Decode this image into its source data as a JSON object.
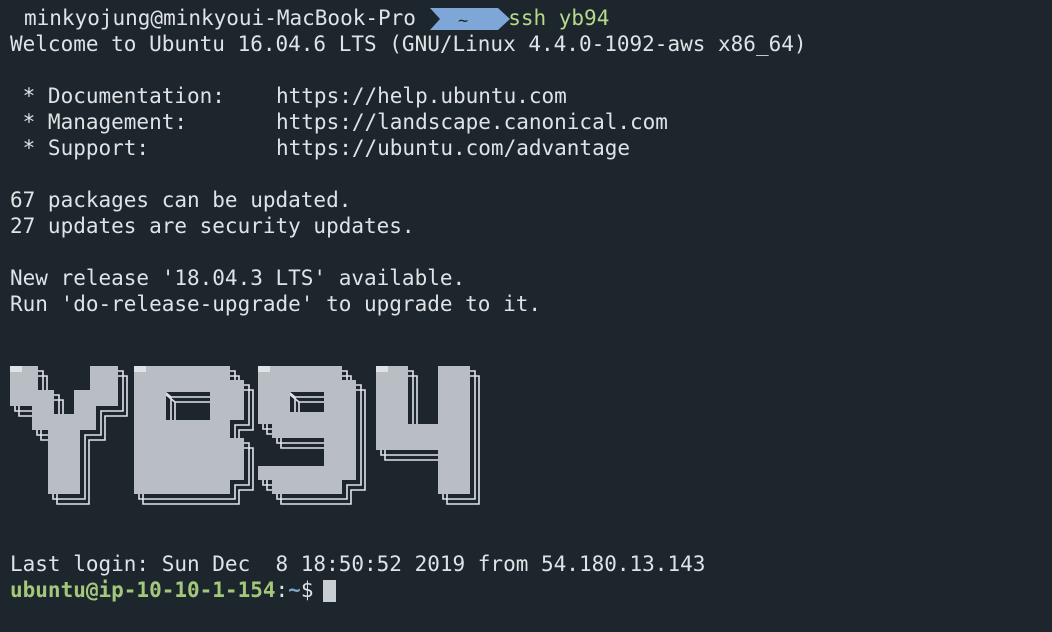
{
  "prompt": {
    "user_host": "minkyojung@minkyoui-MacBook-Pro",
    "dir": "~",
    "command": "ssh yb94"
  },
  "motd": {
    "welcome": "Welcome to Ubuntu 16.04.6 LTS (GNU/Linux 4.4.0-1092-aws x86_64)",
    "links": [
      {
        "label": " * Documentation:",
        "url": "https://help.ubuntu.com"
      },
      {
        "label": " * Management:",
        "url": "https://landscape.canonical.com"
      },
      {
        "label": " * Support:",
        "url": "https://ubuntu.com/advantage"
      }
    ],
    "packages": "67 packages can be updated.",
    "security": "27 updates are security updates.",
    "release": "New release '18.04.3 LTS' available.",
    "upgrade": "Run 'do-release-upgrade' to upgrade to it."
  },
  "banner_text": "YB94",
  "last_login": "Last login: Sun Dec  8 18:50:52 2019 from 54.180.13.143",
  "remote_prompt": {
    "user_host": "ubuntu@ip-10-10-1-154",
    "sep": ":",
    "dir": "~",
    "symbol": "$"
  },
  "colors": {
    "background": "#1c262c",
    "text": "#dfe3e6",
    "badge": "#7ea6d6",
    "command": "#b7d98b",
    "remote_user": "#a3c87c",
    "remote_dir": "#7fa3c6"
  }
}
